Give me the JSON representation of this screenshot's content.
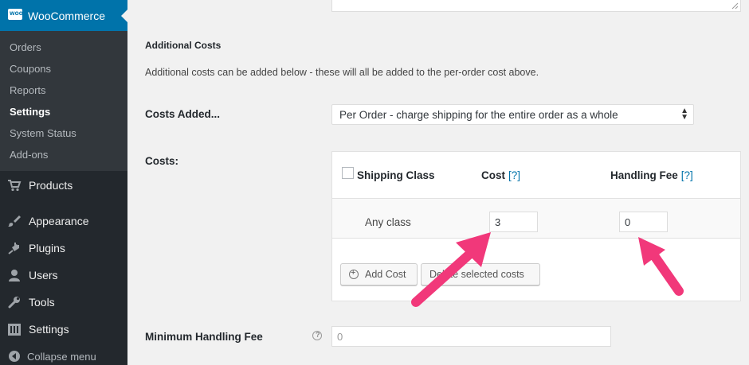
{
  "sidebar": {
    "woocommerce": {
      "label": "WooCommerce",
      "logo_text": "WOO"
    },
    "submenu": [
      {
        "label": "Orders"
      },
      {
        "label": "Coupons"
      },
      {
        "label": "Reports"
      },
      {
        "label": "Settings",
        "current": true
      },
      {
        "label": "System Status"
      },
      {
        "label": "Add-ons"
      }
    ],
    "menu": [
      {
        "label": "Products",
        "icon": "cart-icon"
      },
      {
        "label": "Appearance",
        "icon": "paintbrush-icon"
      },
      {
        "label": "Plugins",
        "icon": "plug-icon"
      },
      {
        "label": "Users",
        "icon": "user-icon"
      },
      {
        "label": "Tools",
        "icon": "wrench-icon"
      },
      {
        "label": "Settings",
        "icon": "settings-sliders-icon"
      }
    ],
    "collapse_label": "Collapse menu"
  },
  "main": {
    "section_title": "Additional Costs",
    "description": "Additional costs can be added below - these will all be added to the per-order cost above.",
    "costs_added": {
      "label": "Costs Added...",
      "selected": "Per Order - charge shipping for the entire order as a whole"
    },
    "costs": {
      "label": "Costs:",
      "headers": {
        "shipping_class": "Shipping Class",
        "cost": "Cost",
        "handling_fee": "Handling Fee",
        "help": "[?]"
      },
      "rows": [
        {
          "class": "Any class",
          "cost": "3",
          "handling_fee": "0"
        }
      ],
      "add_button": "Add Cost",
      "delete_button": "Delete selected costs"
    },
    "minimum_handling_fee": {
      "label": "Minimum Handling Fee",
      "placeholder": "0"
    }
  },
  "colors": {
    "sidebar_bg": "#23282d",
    "submenu_bg": "#32373c",
    "active_blue": "#0073aa",
    "annotation_arrow": "#f1387a"
  }
}
